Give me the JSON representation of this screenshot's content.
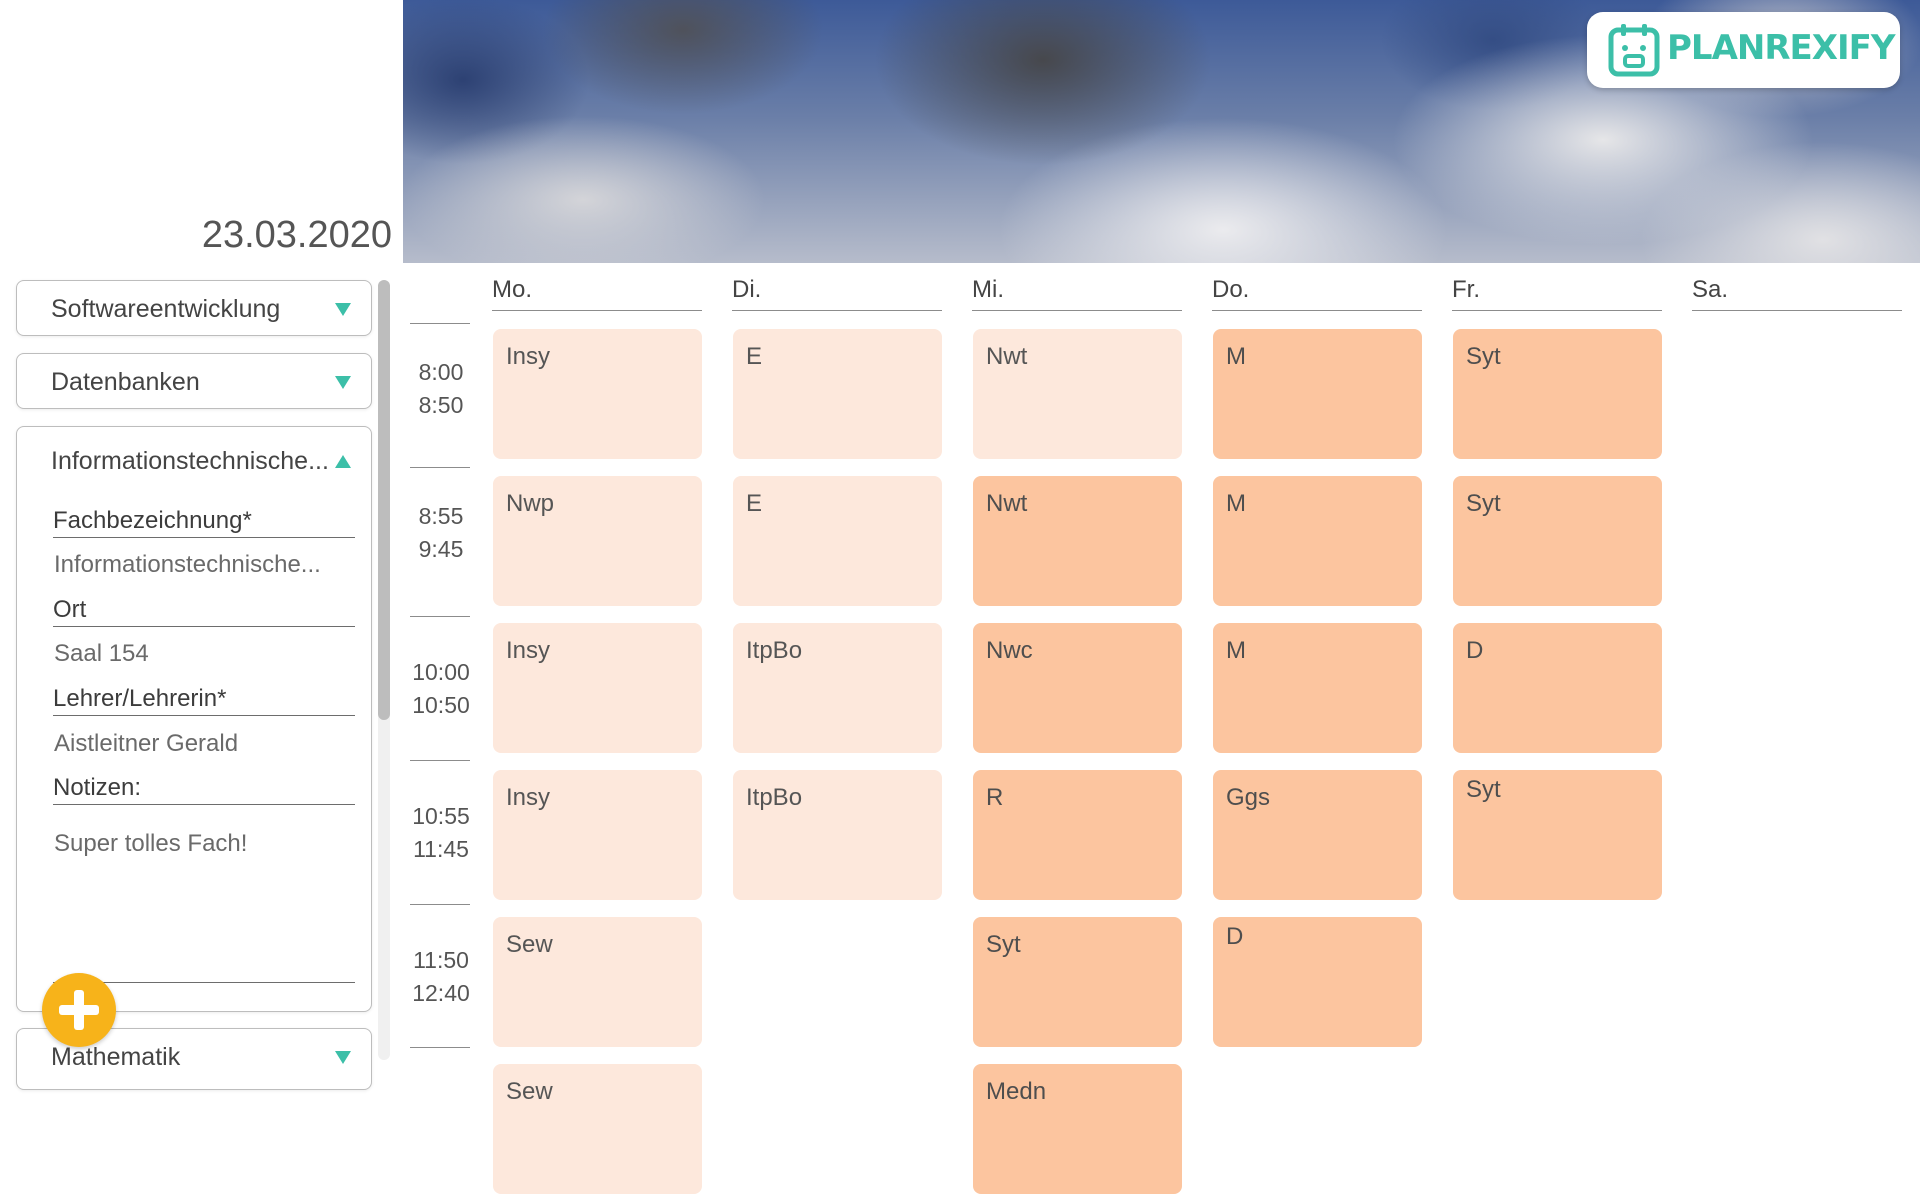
{
  "app": {
    "logo_text": "PLANREXIFY"
  },
  "header": {
    "date": "23.03.2020"
  },
  "sidebar": {
    "subjects": [
      {
        "name": "Softwareentwicklung"
      },
      {
        "name": "Datenbanken"
      },
      {
        "name": "Informationstechnische..."
      },
      {
        "name": "Mathematik"
      }
    ],
    "detail": {
      "fachbezeichnung_label": "Fachbezeichnung*",
      "fachbezeichnung_value": "Informationstechnische...",
      "ort_label": "Ort",
      "ort_value": "Saal 154",
      "lehrer_label": "Lehrer/Lehrerin*",
      "lehrer_value": "Aistleitner Gerald",
      "notizen_label": "Notizen:",
      "notizen_value": "Super tolles Fach!"
    }
  },
  "timetable": {
    "days": [
      "Mo.",
      "Di.",
      "Mi.",
      "Do.",
      "Fr.",
      "Sa."
    ],
    "slots": [
      {
        "start": "8:00",
        "end": "8:50"
      },
      {
        "start": "8:55",
        "end": "9:45"
      },
      {
        "start": "10:00",
        "end": "10:50"
      },
      {
        "start": "10:55",
        "end": "11:45"
      },
      {
        "start": "11:50",
        "end": "12:40"
      }
    ],
    "lessons": {
      "mo": [
        "Insy",
        "Nwp",
        "Insy",
        "Insy",
        "Sew",
        "Sew"
      ],
      "di": [
        "E",
        "E",
        "ItpBo",
        "ItpBo"
      ],
      "mi": [
        "Nwt",
        "Nwt",
        "Nwc",
        "R",
        "Syt",
        "Medn"
      ],
      "do": [
        "M",
        "M",
        "M",
        "Ggs",
        "D"
      ],
      "fr": [
        "Syt",
        "Syt",
        "D",
        "Syt"
      ]
    }
  },
  "colors": {
    "accent": "#3cbfa8",
    "add_button": "#f7b31a",
    "lesson_light": "#fde8dc",
    "lesson_dark": "#fcc59f"
  }
}
